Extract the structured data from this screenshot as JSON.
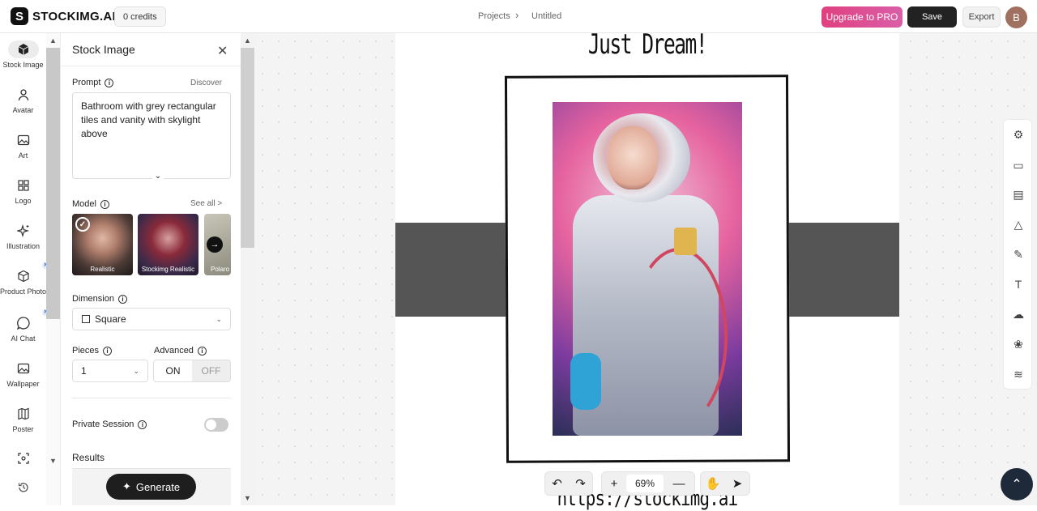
{
  "topbar": {
    "brand": "STOCKIMG.AI",
    "brand_mark": "S",
    "credits": "0 credits",
    "breadcrumb": [
      "Projects",
      "Untitled"
    ],
    "upgrade_label": "Upgrade to PRO",
    "save_label": "Save",
    "export_label": "Export",
    "avatar_initial": "B"
  },
  "leftnav": {
    "items": [
      {
        "label": "Stock Image",
        "icon": "cube-icon",
        "glyph": "⬢",
        "badge": ""
      },
      {
        "label": "Avatar",
        "icon": "person-icon",
        "glyph": "👤",
        "badge": ""
      },
      {
        "label": "Art",
        "icon": "image-icon",
        "glyph": "🖼",
        "badge": ""
      },
      {
        "label": "Logo",
        "icon": "grid-icon",
        "glyph": "▦",
        "badge": ""
      },
      {
        "label": "Illustration",
        "icon": "sparkle-icon",
        "glyph": "✧",
        "badge": ""
      },
      {
        "label": "Product Photo",
        "icon": "box-icon",
        "glyph": "⬡",
        "badge": "NEW"
      },
      {
        "label": "AI Chat",
        "icon": "chat-icon",
        "glyph": "◯",
        "badge": "NEW"
      },
      {
        "label": "Wallpaper",
        "icon": "wallpaper-icon",
        "glyph": "▣",
        "badge": ""
      },
      {
        "label": "Poster",
        "icon": "poster-icon",
        "glyph": "▥",
        "badge": ""
      }
    ],
    "extra_icons": [
      "focus-icon",
      "history-icon"
    ]
  },
  "panel": {
    "title": "Stock Image",
    "close_glyph": "✕",
    "prompt_label": "Prompt",
    "discover_label": "Discover",
    "prompt_value": "Bathroom with grey rectangular tiles and vanity with skylight above",
    "model_label": "Model",
    "see_all_label": "See all >",
    "models": [
      {
        "name": "Realistic",
        "selected": true
      },
      {
        "name": "Stockimg Realistic",
        "selected": false
      },
      {
        "name": "Polaro",
        "selected": false
      }
    ],
    "dimension_label": "Dimension",
    "dimension_value": "Square",
    "pieces_label": "Pieces",
    "pieces_value": "1",
    "advanced_label": "Advanced",
    "advanced_on": "ON",
    "advanced_off": "OFF",
    "private_label": "Private Session",
    "private_enabled": false,
    "results_label": "Results",
    "generate_label": "Generate"
  },
  "canvas": {
    "page_title": "Just Dream!",
    "page_url": "https://stockimg.ai",
    "zoom": "69%",
    "colors": {
      "band": "#555555",
      "frame": "#111111"
    }
  },
  "right_tools": [
    "settings-icon",
    "folder-icon",
    "layout-icon",
    "shapes-icon",
    "brush-icon",
    "text-icon",
    "upload-icon",
    "sticker-icon",
    "layers-icon"
  ],
  "colors": {
    "accent_pink": "#e0407f",
    "dark": "#222222",
    "fab": "#1e2a3a"
  }
}
